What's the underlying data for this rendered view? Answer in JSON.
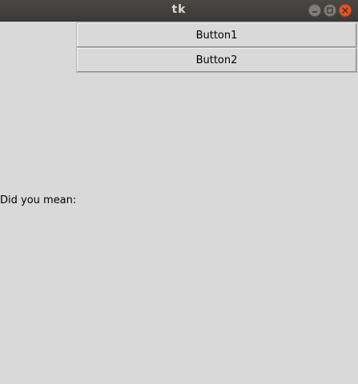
{
  "window": {
    "title": "tk",
    "controls": {
      "minimize_icon": "minimize-icon",
      "maximize_icon": "maximize-icon",
      "close_icon": "close-icon"
    },
    "colors": {
      "titlebar": "#3c3b37",
      "close": "#e95420",
      "background": "#d9d9d9"
    }
  },
  "main": {
    "button1_label": "Button1",
    "button2_label": "Button2",
    "suggestion_label": "Did you mean:"
  }
}
